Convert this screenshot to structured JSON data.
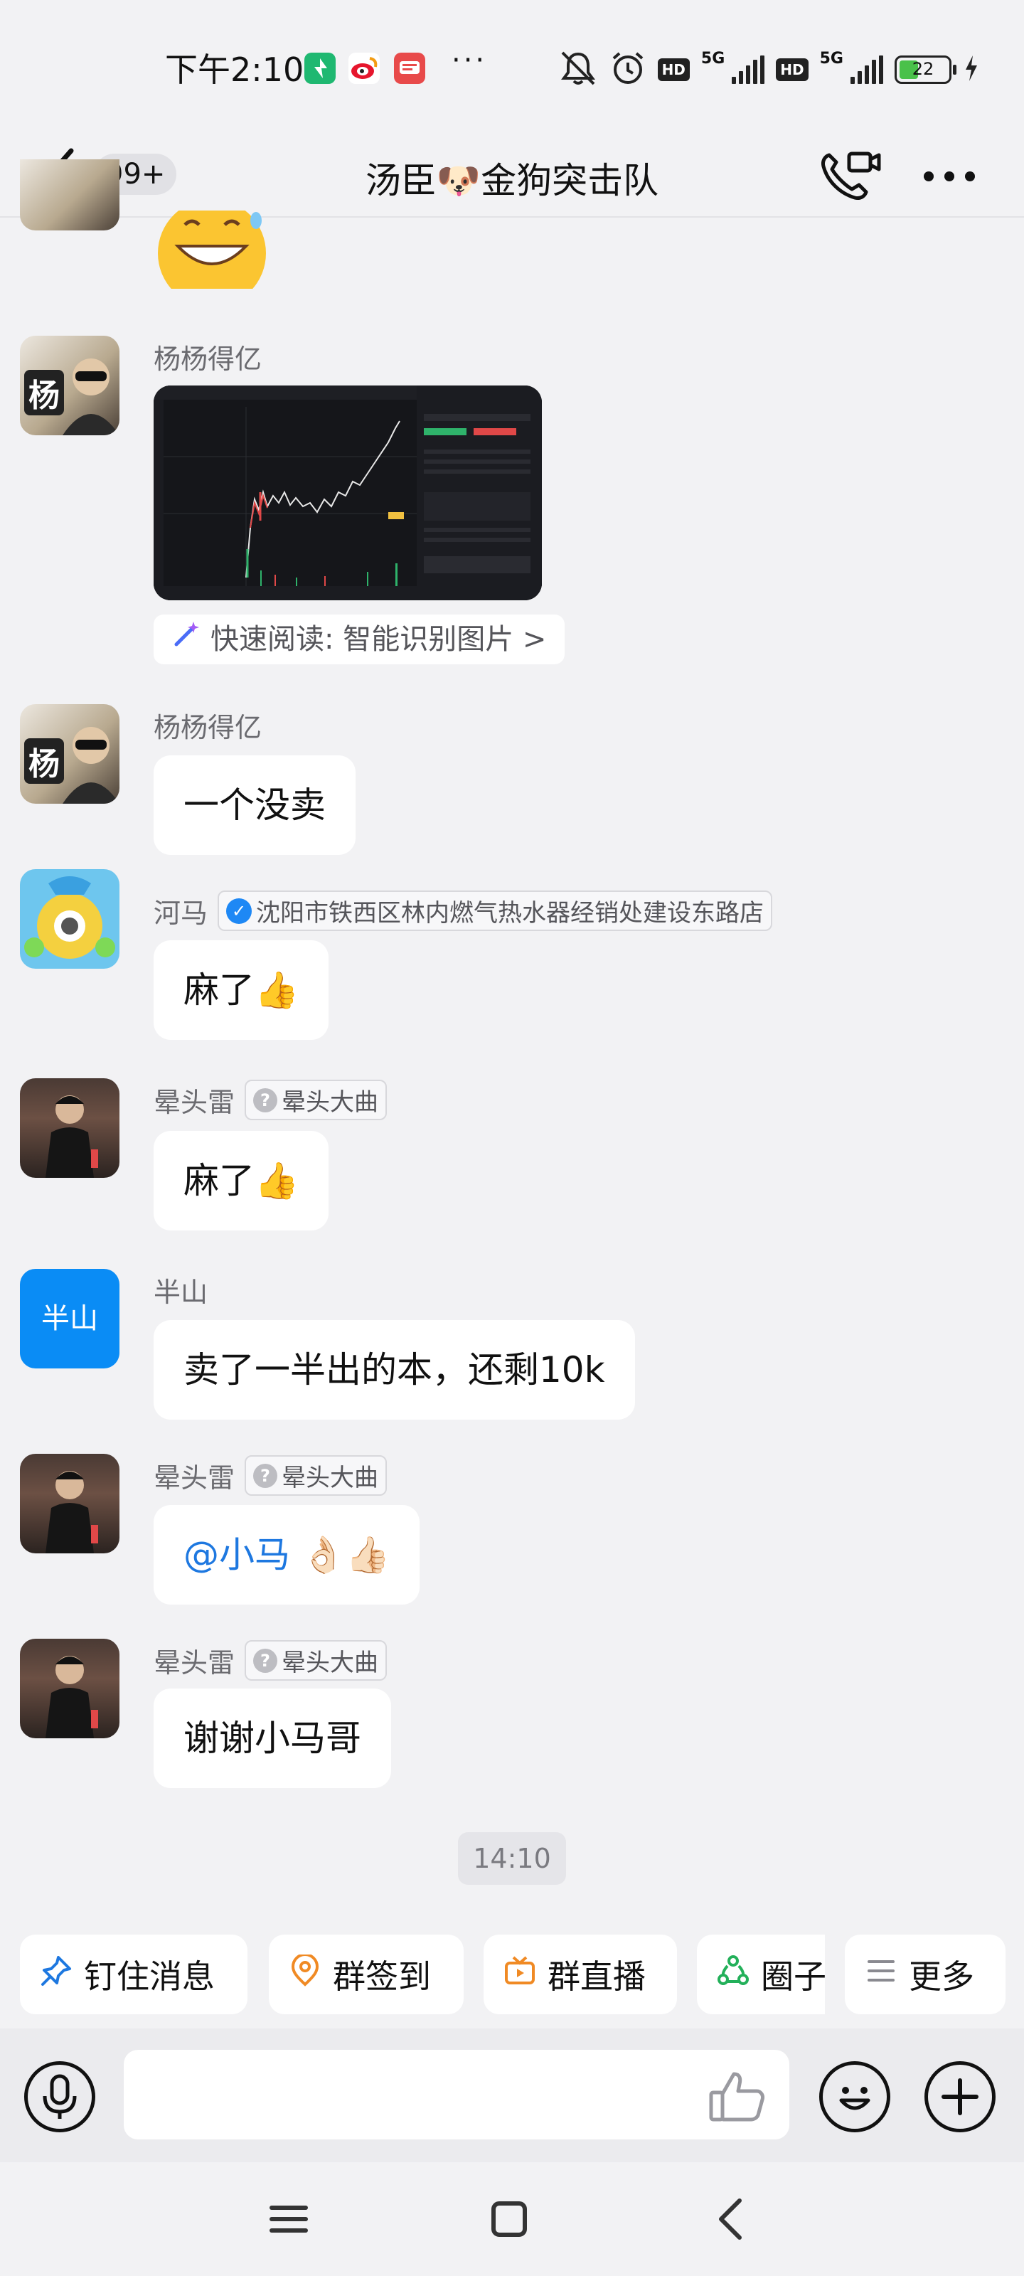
{
  "status_bar": {
    "time": "下午2:10",
    "battery": "22",
    "network_1": "5G",
    "network_2": "5G",
    "hd_1": "HD",
    "hd_2": "HD",
    "more_dots": "···"
  },
  "header": {
    "unread_badge": "99+",
    "title": "汤臣🐶金狗突击队"
  },
  "messages": [
    {
      "type": "emoji",
      "content": "grinning-face-sweat"
    },
    {
      "sender": "杨杨得亿",
      "avatar_char": "杨",
      "type": "image",
      "image": "stock-chart-screenshot",
      "quick_read": "快速阅读: 智能识别图片 >"
    },
    {
      "sender": "杨杨得亿",
      "avatar_char": "杨",
      "text": "一个没卖"
    },
    {
      "sender": "河马",
      "tag": "沈阳市铁西区林内燃气热水器经销处建设东路店",
      "text": "麻了👍"
    },
    {
      "sender": "晕头雷",
      "tag": "晕头大曲",
      "text": "麻了👍"
    },
    {
      "sender": "半山",
      "avatar_text": "半山",
      "text": "卖了一半出的本，还剩10k"
    },
    {
      "sender": "晕头雷",
      "tag": "晕头大曲",
      "mention": "@小马",
      "emojis": "👌🏻👍🏻"
    },
    {
      "sender": "晕头雷",
      "tag": "晕头大曲",
      "text": "谢谢小马哥"
    }
  ],
  "timestamp": "14:10",
  "quick_actions": [
    {
      "label": "钉住消息",
      "icon": "pin-icon",
      "color": "#1e78e0"
    },
    {
      "label": "群签到",
      "icon": "location-icon",
      "color": "#f08a24"
    },
    {
      "label": "群直播",
      "icon": "tv-icon",
      "color": "#f08a24"
    },
    {
      "label": "圈子",
      "icon": "circle-network-icon",
      "color": "#23b05a"
    },
    {
      "label": "更多",
      "icon": "menu-icon",
      "color": "#8a8a90"
    }
  ],
  "input": {
    "placeholder": ""
  }
}
